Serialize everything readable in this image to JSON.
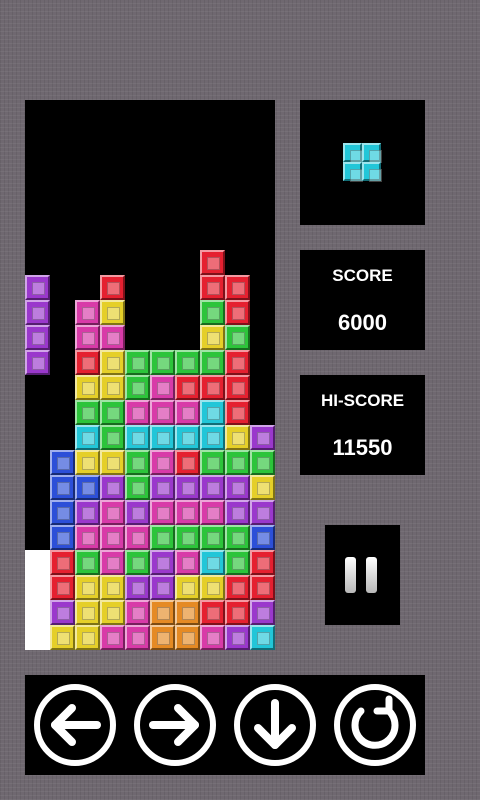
{
  "colors": {
    "R": "#e52030",
    "G": "#2cc43a",
    "Y": "#e5cf28",
    "P": "#d83aa8",
    "V": "#9a38cc",
    "B": "#2c4fd8",
    "C": "#22c6d8",
    "O": "#e58a24",
    "W": "#ffffff"
  },
  "board": {
    "cols": 10,
    "rows": 22,
    "grid": [
      "..........",
      "..........",
      "..........",
      "..........",
      "..........",
      "..........",
      ".......R..",
      "V..R...RR.",
      "V.PY...GR.",
      "V.PP...YG.",
      "V.RYGGGGR.",
      "..YYGPRRR.",
      "..GGPPPCR.",
      "..CGCCCCYV",
      ".BYYGPRGGG",
      ".BBVGVVVVY",
      ".BVPVPPPVV",
      ".BPPPGGGGB",
      "WRGPGVPCGR",
      "WRYYVVYYRR",
      "WVYYPOORRV",
      "WYYPPOOPVC"
    ]
  },
  "next_piece": {
    "color": "C",
    "cells": [
      [
        0,
        0
      ],
      [
        1,
        0
      ],
      [
        0,
        1
      ],
      [
        1,
        1
      ]
    ]
  },
  "score": {
    "label": "SCORE",
    "value": "6000"
  },
  "hiscore": {
    "label": "HI-SCORE",
    "value": "11550"
  },
  "icons": {
    "pause": "pause-icon",
    "left": "arrow-left-icon",
    "right": "arrow-right-icon",
    "down": "arrow-down-icon",
    "rotate": "rotate-icon"
  }
}
